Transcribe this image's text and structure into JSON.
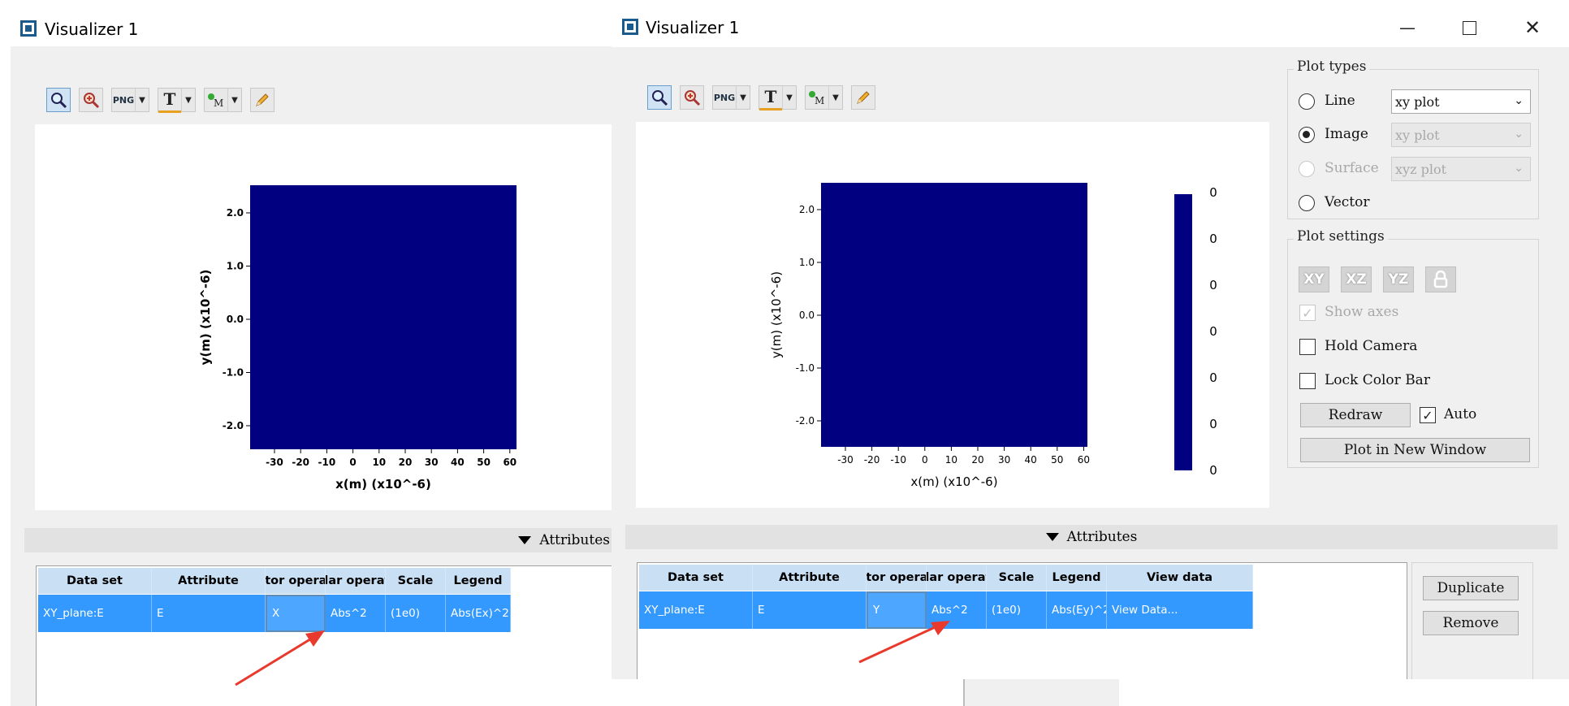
{
  "left_window": {
    "title": "Visualizer 1",
    "attributes_label": "Attributes",
    "table": {
      "headers": [
        "Data set",
        "Attribute",
        "ctor operat",
        "alar operati",
        "Scale",
        "Legend"
      ],
      "row": [
        "XY_plane:E",
        "E",
        "X",
        "Abs^2",
        "(1e0)",
        "Abs(Ex)^2"
      ]
    },
    "plot": {
      "xlabel": "x(m) (x10^-6)",
      "ylabel": "y(m) (x10^-6)",
      "xticks": [
        "-30",
        "-20",
        "-10",
        "0",
        "10",
        "20",
        "30",
        "40",
        "50",
        "60"
      ],
      "yticks": [
        "2.0",
        "1.0",
        "0.0",
        "-1.0",
        "-2.0"
      ]
    }
  },
  "right_window": {
    "title": "Visualizer 1",
    "attributes_label": "Attributes",
    "table": {
      "headers": [
        "Data set",
        "Attribute",
        "ctor operat",
        "alar operati",
        "Scale",
        "Legend",
        "View data"
      ],
      "row": [
        "XY_plane:E",
        "E",
        "Y",
        "Abs^2",
        "(1e0)",
        "Abs(Ey)^2",
        "View Data..."
      ]
    },
    "plot": {
      "xlabel": "x(m) (x10^-6)",
      "ylabel": "y(m) (x10^-6)",
      "xticks": [
        "-30",
        "-20",
        "-10",
        "0",
        "10",
        "20",
        "30",
        "40",
        "50",
        "60"
      ],
      "yticks": [
        "2.0",
        "1.0",
        "0.0",
        "-1.0",
        "-2.0"
      ],
      "colorbar_ticks": [
        "0",
        "0",
        "0",
        "0",
        "0",
        "0",
        "0"
      ]
    },
    "plot_types": {
      "title": "Plot types",
      "line": "Line",
      "image": "Image",
      "surface": "Surface",
      "vector": "Vector",
      "line_combo": "xy plot",
      "image_combo": "xy plot",
      "surface_combo": "xyz plot",
      "selected": "Image"
    },
    "plot_settings": {
      "title": "Plot settings",
      "views": [
        "XY",
        "XZ",
        "YZ"
      ],
      "show_axes": "Show axes",
      "hold_camera": "Hold Camera",
      "lock_color_bar": "Lock Color Bar",
      "redraw": "Redraw",
      "auto": "Auto",
      "plot_new_window": "Plot in New Window"
    },
    "side_buttons": {
      "duplicate": "Duplicate",
      "remove": "Remove"
    }
  },
  "colors": {
    "plot_fill": "#000080",
    "selection": "#3399ff",
    "header": "#c8dff4",
    "arrow": "#e8392c"
  }
}
